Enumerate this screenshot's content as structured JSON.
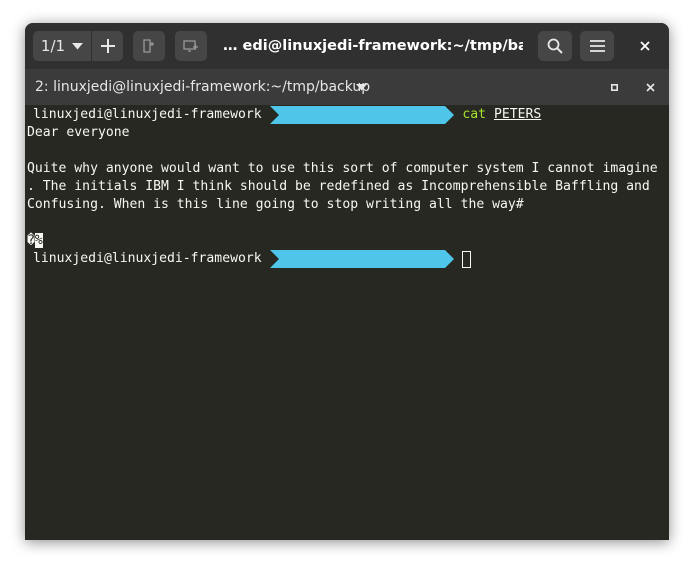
{
  "titlebar": {
    "session_count": "1/1",
    "title": "… edi@linuxjedi-framework:~/tmp/backup",
    "icons": {
      "session_menu": "chevron-down-icon",
      "new_terminal": "plus-icon",
      "new_tab": "new-tab-icon",
      "new_window": "new-window-icon",
      "search": "search-icon",
      "menu": "hamburger-icon",
      "close": "close-icon"
    }
  },
  "tab": {
    "label": "2: linuxjedi@linuxjedi-framework:~/tmp/backup"
  },
  "terminal": {
    "prompt_user": "linuxjedi@linuxjedi-framework",
    "prompt_dir": "~/tmp/backup",
    "command": "cat",
    "argument": "PETERS",
    "output_lines": [
      "Dear everyone",
      "",
      "Quite why anyone would want to use this sort of computer system I cannot imagine",
      ". The initials IBM I think should be redefined as Incomprehensible Baffling and",
      "Confusing. When is this line going to stop writing all the way#",
      "",
      ""
    ],
    "garbage_char": "�",
    "eol_marker": "%",
    "colors": {
      "background": "#272822",
      "foreground": "#f8f8f2",
      "prompt_dir_bg": "#4fc6e9",
      "command": "#a6e22e"
    }
  }
}
